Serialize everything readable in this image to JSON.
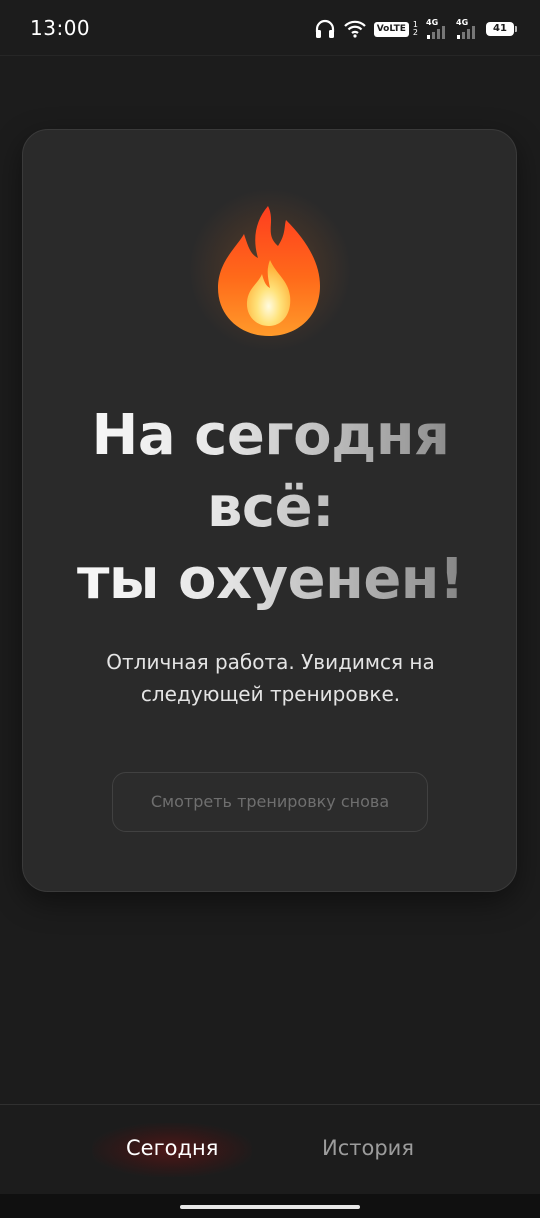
{
  "status_bar": {
    "time": "13:00",
    "volte": "VoLTE",
    "sim_numbers": [
      "1",
      "2"
    ],
    "network_1": "4G",
    "network_2": "4G",
    "battery": "41",
    "icons": [
      "headphones-icon",
      "wifi-icon",
      "signal-icon",
      "battery-icon"
    ]
  },
  "card": {
    "emoji": "fire-icon",
    "headline": [
      "На сегодня",
      "всё:",
      "ты охуенен!"
    ],
    "subtitle": [
      "Отличная работа. Увидимся на",
      "следующей тренировке."
    ],
    "rewatch_button": "Смотреть тренировку снова"
  },
  "bottom_nav": {
    "tabs": [
      {
        "label": "Сегодня",
        "active": true
      },
      {
        "label": "История",
        "active": false
      }
    ]
  },
  "colors": {
    "background": "#1c1c1c",
    "card": "#2a2a2a",
    "active_glow": "#5a0f0f",
    "inactive_tab": "#9c9c9c"
  }
}
